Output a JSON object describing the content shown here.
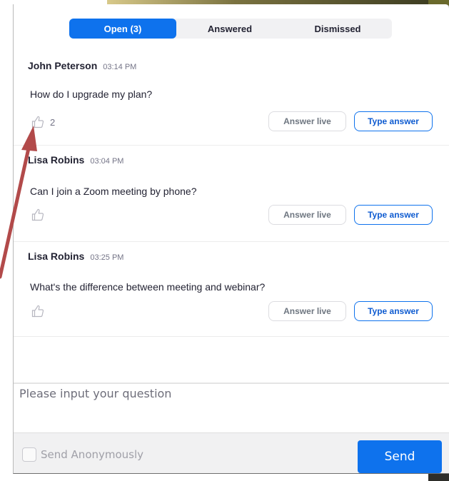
{
  "tabs": [
    {
      "label": "Open (3)",
      "active": true
    },
    {
      "label": "Answered",
      "active": false
    },
    {
      "label": "Dismissed",
      "active": false
    }
  ],
  "questions": [
    {
      "name": "John Peterson",
      "time": "03:14 PM",
      "text": "How do I upgrade my plan?",
      "likes": "2",
      "answer_live": "Answer live",
      "type_answer": "Type answer"
    },
    {
      "name": "Lisa Robins",
      "time": "03:04 PM",
      "text": "Can I join a Zoom meeting by phone?",
      "likes": "",
      "answer_live": "Answer live",
      "type_answer": "Type answer"
    },
    {
      "name": "Lisa Robins",
      "time": "03:25 PM",
      "text": "What's the difference between meeting and webinar?",
      "likes": "",
      "answer_live": "Answer live",
      "type_answer": "Type answer"
    }
  ],
  "composer": {
    "placeholder": "Please input your question",
    "value": ""
  },
  "footer": {
    "anonymous_label": "Send Anonymously",
    "anonymous_checked": false,
    "send_label": "Send"
  },
  "colors": {
    "accent": "#0e72ed",
    "annotation_arrow": "#b24a4a"
  },
  "icons": {
    "like": "thumbs-up-icon"
  }
}
